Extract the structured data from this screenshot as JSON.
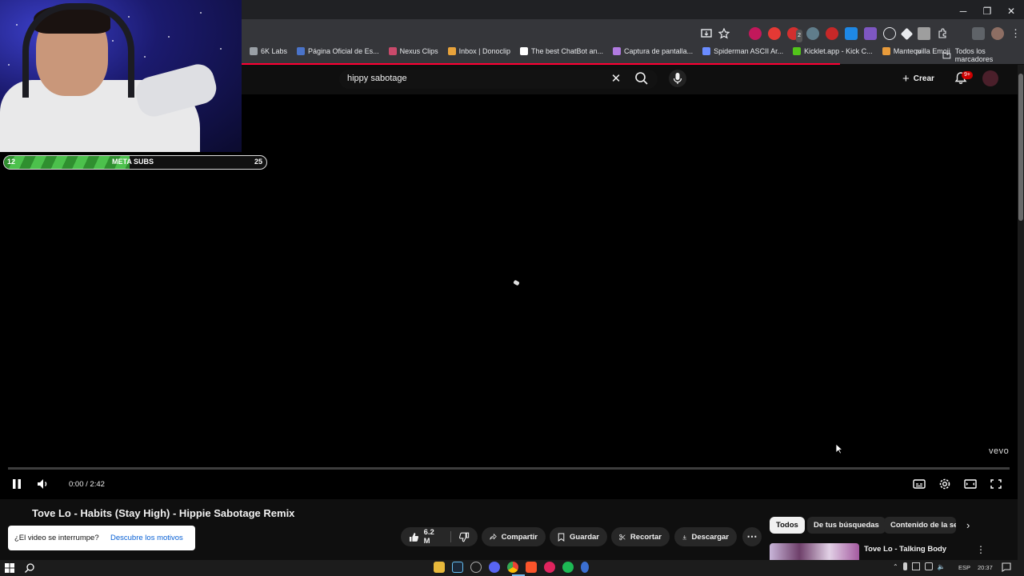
{
  "browser": {
    "bookmarks": [
      {
        "label": "6K Labs",
        "color": "#9aa0a6"
      },
      {
        "label": "Página Oficial de Es...",
        "color": "#4a73c9"
      },
      {
        "label": "Nexus Clips",
        "color": "#c94a6b"
      },
      {
        "label": "Inbox | Donoclip",
        "color": "#e8a33b"
      },
      {
        "label": "The best ChatBot an...",
        "color": "#ffffff"
      },
      {
        "label": "Captura de pantalla...",
        "color": "#b07ae0"
      },
      {
        "label": "Spiderman ASCII Ar...",
        "color": "#6a8cff"
      },
      {
        "label": "Kicklet.app - Kick C...",
        "color": "#52c41a"
      },
      {
        "label": "Mantequilla Emoji",
        "color": "#e89b3b"
      }
    ],
    "bookmarks_overflow": "»",
    "all_bookmarks": "Todos los marcadores",
    "notification_badge": "2"
  },
  "youtube": {
    "search_query": "hippy sabotage",
    "create_label": "Crear",
    "bell_badge": "9+",
    "brand_color": "#ff0033"
  },
  "player": {
    "time": "0:00 / 2:42",
    "watermark": "vevo"
  },
  "stream_overlay": {
    "subs_current": "12",
    "subs_label": "META SUBS",
    "subs_goal": "25",
    "progress_fraction": 0.48
  },
  "video": {
    "title": "Tove Lo - Habits (Stay High) - Hippie Sabotage Remix",
    "likes": "6.2 M",
    "share": "Compartir",
    "save": "Guardar",
    "clip": "Recortar",
    "download": "Descargar"
  },
  "toast": {
    "text": "¿El video se interrumpe?",
    "link": "Descubre los motivos"
  },
  "related": {
    "chips": [
      "Todos",
      "De tus búsquedas",
      "Contenido de la ser"
    ],
    "first_title": "Tove Lo - Talking Body"
  },
  "taskbar": {
    "lang": "ESP",
    "time": "20:37"
  }
}
